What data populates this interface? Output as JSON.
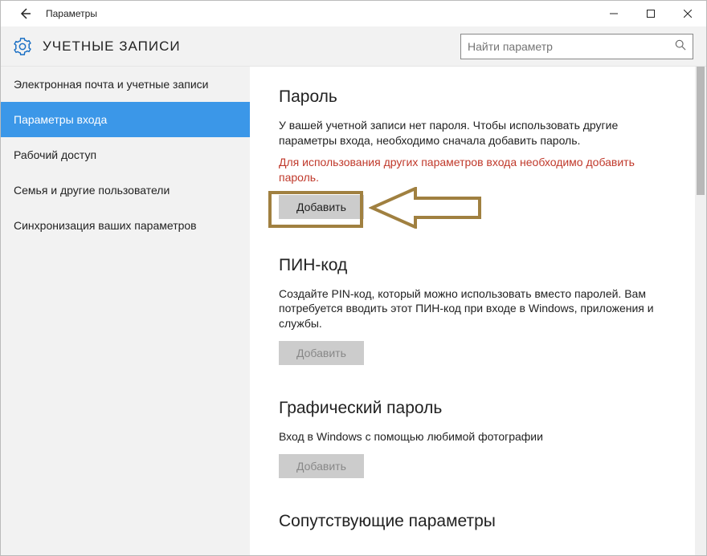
{
  "titlebar": {
    "title": "Параметры"
  },
  "header": {
    "section_title": "УЧЕТНЫЕ ЗАПИСИ",
    "search_placeholder": "Найти параметр"
  },
  "sidebar": {
    "items": [
      {
        "label": "Электронная почта и учетные записи",
        "selected": false
      },
      {
        "label": "Параметры входа",
        "selected": true
      },
      {
        "label": "Рабочий доступ",
        "selected": false
      },
      {
        "label": "Семья и другие пользователи",
        "selected": false
      },
      {
        "label": "Синхронизация ваших параметров",
        "selected": false
      }
    ]
  },
  "content": {
    "password": {
      "heading": "Пароль",
      "desc": "У вашей учетной записи нет пароля. Чтобы использовать другие параметры входа, необходимо сначала добавить пароль.",
      "warn": "Для использования других параметров входа необходимо добавить пароль.",
      "button": "Добавить"
    },
    "pin": {
      "heading": "ПИН-код",
      "desc": "Создайте PIN-код, который можно использовать вместо паролей. Вам потребуется вводить этот ПИН-код при входе в Windows, приложения и службы.",
      "button": "Добавить"
    },
    "picture": {
      "heading": "Графический пароль",
      "desc": "Вход в Windows с помощью любимой фотографии",
      "button": "Добавить"
    },
    "related": {
      "heading": "Сопутствующие параметры"
    }
  }
}
